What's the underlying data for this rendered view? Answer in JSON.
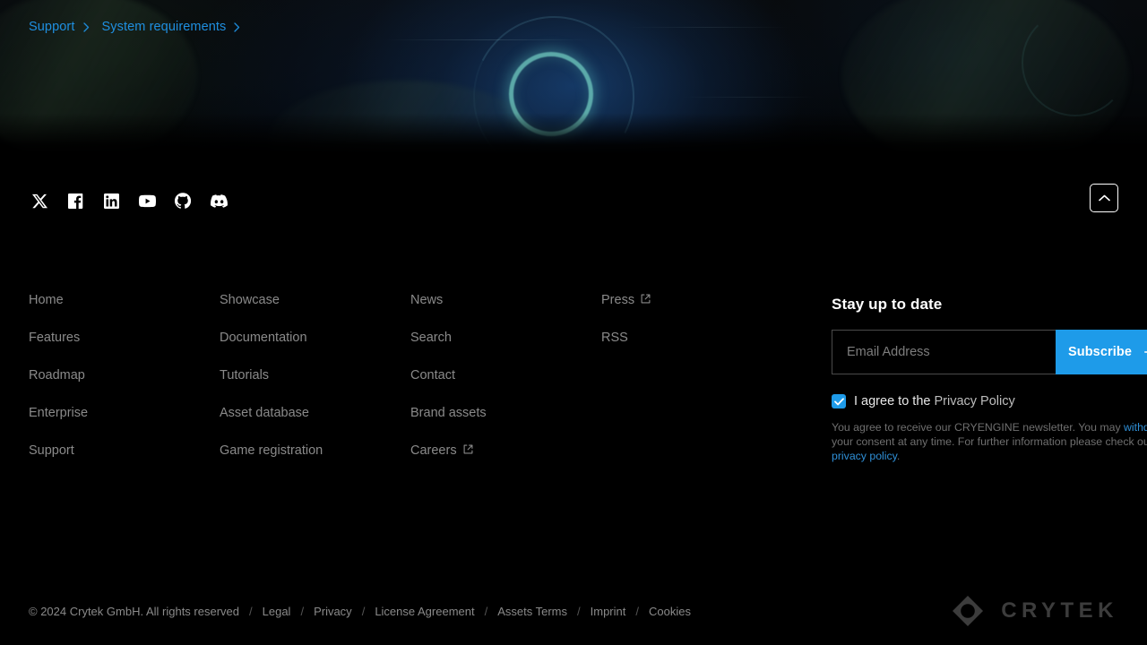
{
  "breadcrumb": {
    "items": [
      {
        "label": "Support"
      },
      {
        "label": "System requirements"
      }
    ]
  },
  "social": {
    "items": [
      {
        "name": "x-icon",
        "label": "X"
      },
      {
        "name": "facebook-icon",
        "label": "Facebook"
      },
      {
        "name": "linkedin-icon",
        "label": "LinkedIn"
      },
      {
        "name": "youtube-icon",
        "label": "YouTube"
      },
      {
        "name": "github-icon",
        "label": "GitHub"
      },
      {
        "name": "discord-icon",
        "label": "Discord"
      }
    ]
  },
  "scroll_to_top": {
    "label": "Back to top"
  },
  "footer_columns": [
    {
      "links": [
        {
          "label": "Home",
          "external": false
        },
        {
          "label": "Features",
          "external": false
        },
        {
          "label": "Roadmap",
          "external": false
        },
        {
          "label": "Enterprise",
          "external": false
        },
        {
          "label": "Support",
          "external": false
        }
      ]
    },
    {
      "links": [
        {
          "label": "Showcase",
          "external": false
        },
        {
          "label": "Documentation",
          "external": false
        },
        {
          "label": "Tutorials",
          "external": false
        },
        {
          "label": "Asset database",
          "external": false
        },
        {
          "label": "Game registration",
          "external": false
        }
      ]
    },
    {
      "links": [
        {
          "label": "News",
          "external": false
        },
        {
          "label": "Search",
          "external": false
        },
        {
          "label": "Contact",
          "external": false
        },
        {
          "label": "Brand assets",
          "external": false
        },
        {
          "label": "Careers",
          "external": true
        }
      ]
    },
    {
      "links": [
        {
          "label": "Press",
          "external": true
        },
        {
          "label": "RSS",
          "external": false
        }
      ]
    }
  ],
  "newsletter": {
    "title": "Stay up to date",
    "email_placeholder": "Email Address",
    "email_value": "",
    "subscribe_label": "Subscribe",
    "consent_checked": true,
    "consent_text": "I agree to the ",
    "consent_link": "Privacy Policy",
    "disclaimer_1": "You agree to receive our CRYENGINE newsletter. You may ",
    "disclaimer_link_1": "withdraw",
    "disclaimer_2": " your consent at any time. For further information please check out our ",
    "disclaimer_link_2": "privacy policy",
    "disclaimer_3": "."
  },
  "bottom": {
    "copyright": "© 2024 Crytek GmbH. All rights reserved",
    "links": [
      {
        "label": "Legal"
      },
      {
        "label": "Privacy"
      },
      {
        "label": "License Agreement"
      },
      {
        "label": "Assets Terms"
      },
      {
        "label": "Imprint"
      },
      {
        "label": "Cookies"
      }
    ],
    "separator": "/",
    "brand": "CRYTEK"
  },
  "colors": {
    "accent_blue": "#1e9be9",
    "breadcrumb_blue": "#1f8fe0",
    "link_gray": "#8a8a8a",
    "background": "#000000",
    "ring_teal": "#6ec8be"
  }
}
